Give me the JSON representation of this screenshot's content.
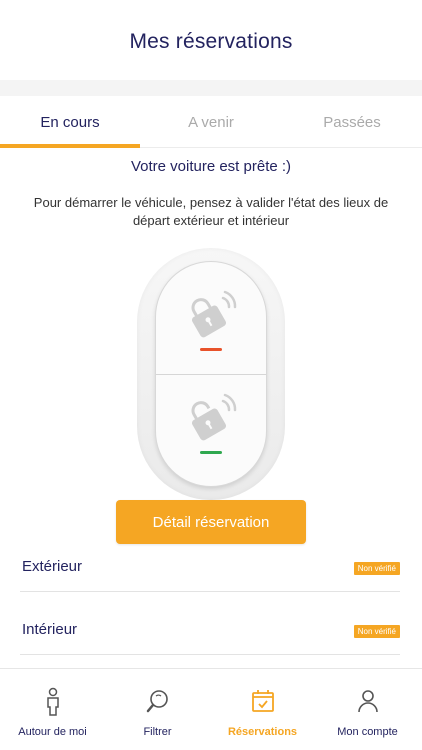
{
  "header": {
    "title": "Mes réservations"
  },
  "tabs": [
    {
      "label": "En cours",
      "active": true
    },
    {
      "label": "A venir",
      "active": false
    },
    {
      "label": "Passées",
      "active": false
    }
  ],
  "status": {
    "ready_text": "Votre voiture est prête :)",
    "instructions": "Pour démarrer le véhicule, pensez à valider l'état des lieux de départ extérieur et intérieur"
  },
  "remote": {
    "lock_icon": "lock-icon",
    "unlock_icon": "unlock-icon",
    "lock_color": "#e8522a",
    "unlock_color": "#2fa84f"
  },
  "detail_button": {
    "label": "Détail réservation"
  },
  "inspections": [
    {
      "label": "Extérieur",
      "status": "Non vérifié"
    },
    {
      "label": "Intérieur",
      "status": "Non vérifié"
    }
  ],
  "tabbar": [
    {
      "label": "Autour de moi",
      "icon": "person-icon",
      "active": false
    },
    {
      "label": "Filtrer",
      "icon": "search-icon",
      "active": false
    },
    {
      "label": "Réservations",
      "icon": "calendar-icon",
      "active": true
    },
    {
      "label": "Mon compte",
      "icon": "account-icon",
      "active": false
    }
  ],
  "colors": {
    "accent": "#f5a623",
    "primary_text": "#23235f"
  }
}
